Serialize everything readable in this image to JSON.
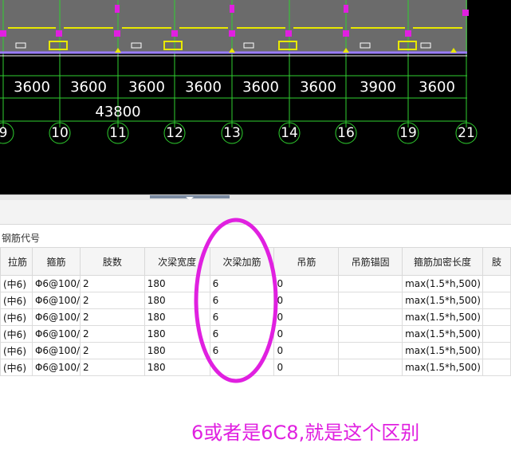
{
  "drawing": {
    "dimensions": [
      "3600",
      "3600",
      "3600",
      "3600",
      "3600",
      "3600",
      "3900",
      "3600"
    ],
    "total_dimension": "43800",
    "axis_labels": [
      "9",
      "10",
      "11",
      "12",
      "13",
      "14",
      "16",
      "19",
      "21"
    ]
  },
  "panel": {
    "title": "钢筋代号"
  },
  "table": {
    "headers": [
      "拉筋",
      "箍筋",
      "肢数",
      "次梁宽度",
      "次梁加筋",
      "吊筋",
      "吊筋锚固",
      "箍筋加密长度",
      "肢"
    ],
    "rows": [
      [
        "(中6)",
        "Φ6@100/",
        "2",
        "180",
        "6",
        "0",
        "",
        "max(1.5*h,500)",
        ""
      ],
      [
        "(中6)",
        "Φ6@100/",
        "2",
        "180",
        "6",
        "0",
        "",
        "max(1.5*h,500)",
        ""
      ],
      [
        "(中6)",
        "Φ6@100/",
        "2",
        "180",
        "6",
        "0",
        "",
        "max(1.5*h,500)",
        ""
      ],
      [
        "(中6)",
        "Φ6@100/",
        "2",
        "180",
        "6",
        "0",
        "",
        "max(1.5*h,500)",
        ""
      ],
      [
        "(中6)",
        "Φ6@100/",
        "2",
        "180",
        "6",
        "0",
        "",
        "max(1.5*h,500)",
        ""
      ],
      [
        "(中6)",
        "Φ6@100/",
        "2",
        "180",
        "",
        "0",
        "",
        "max(1.5*h,500)",
        ""
      ]
    ]
  },
  "annotation": {
    "note": "6或者是6C8,就是这个区别",
    "color": "#e020e0"
  }
}
